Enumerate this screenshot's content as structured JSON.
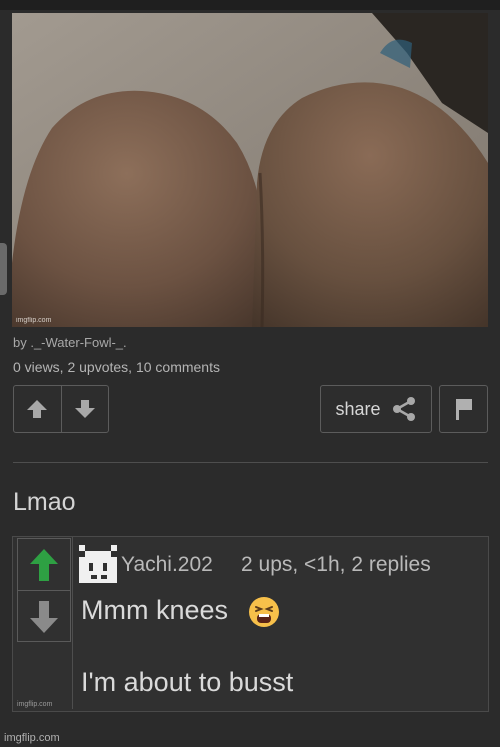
{
  "post": {
    "image_watermark": "imgflip.com",
    "author": "by ._-Water-Fowl-_.",
    "stats": "0 views, 2 upvotes, 10 comments",
    "share_label": "share",
    "title": "Lmao"
  },
  "icons": {
    "upvote": "up-arrow-icon",
    "downvote": "down-arrow-icon",
    "share": "share-icon",
    "flag": "flag-icon"
  },
  "comment": {
    "username": "Yachi.202",
    "meta": "2 ups, <1h, 2 replies",
    "line1": "Mmm knees",
    "line2": "I'm about to busst",
    "emoji": "tired-face-emoji",
    "watermark": "imgflip.com"
  },
  "footer": {
    "watermark": "imgflip.com"
  },
  "colors": {
    "background": "#2b2b2b",
    "upvote_active": "#2ea043",
    "text": "#d4d4d4"
  }
}
